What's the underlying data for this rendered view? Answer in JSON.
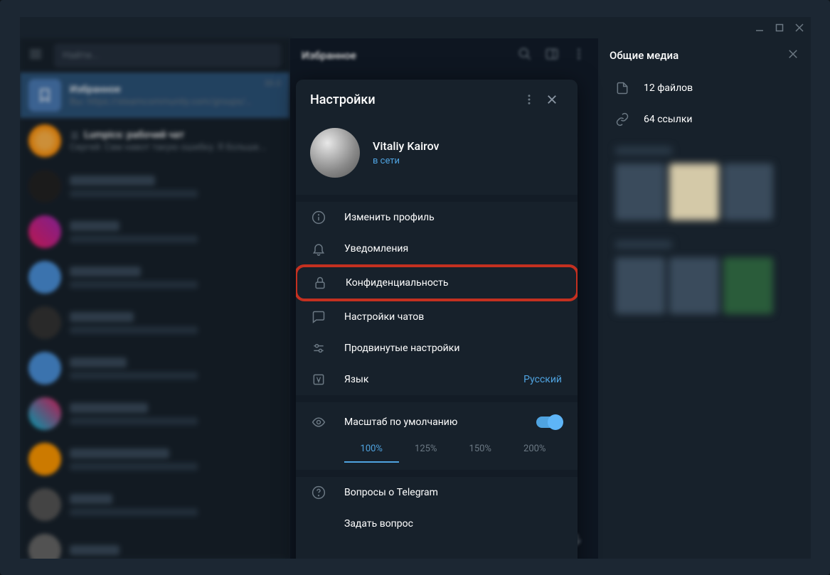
{
  "window": {
    "title_bar": {}
  },
  "left": {
    "search_placeholder": "Найти...",
    "chats": [
      {
        "title": "Избранное",
        "time": "30.0",
        "subtitle": "Вы: https://steamcommunity.com/groups/mk..."
      },
      {
        "title": "Lumpics: рабочий чат",
        "subtitle": "Сергей: Сам навот такую ошибку. Я больше..."
      }
    ]
  },
  "center": {
    "title": "Избранное"
  },
  "right": {
    "title": "Общие медиа",
    "files": "12 файлов",
    "links": "64 ссылки"
  },
  "settings": {
    "title": "Настройки",
    "user_name": "Vitaliy Kairov",
    "user_status": "в сети",
    "items": {
      "edit_profile": "Изменить профиль",
      "notifications": "Уведомления",
      "privacy": "Конфиденциальность",
      "chat_settings": "Настройки чатов",
      "advanced": "Продвинутые настройки",
      "language": "Язык",
      "language_value": "Русский"
    },
    "zoom": {
      "label": "Масштаб по умолчанию",
      "options": [
        "100%",
        "125%",
        "150%",
        "200%"
      ],
      "active": "100%"
    },
    "help": {
      "faq": "Вопросы о Telegram",
      "ask": "Задать вопрос"
    }
  }
}
